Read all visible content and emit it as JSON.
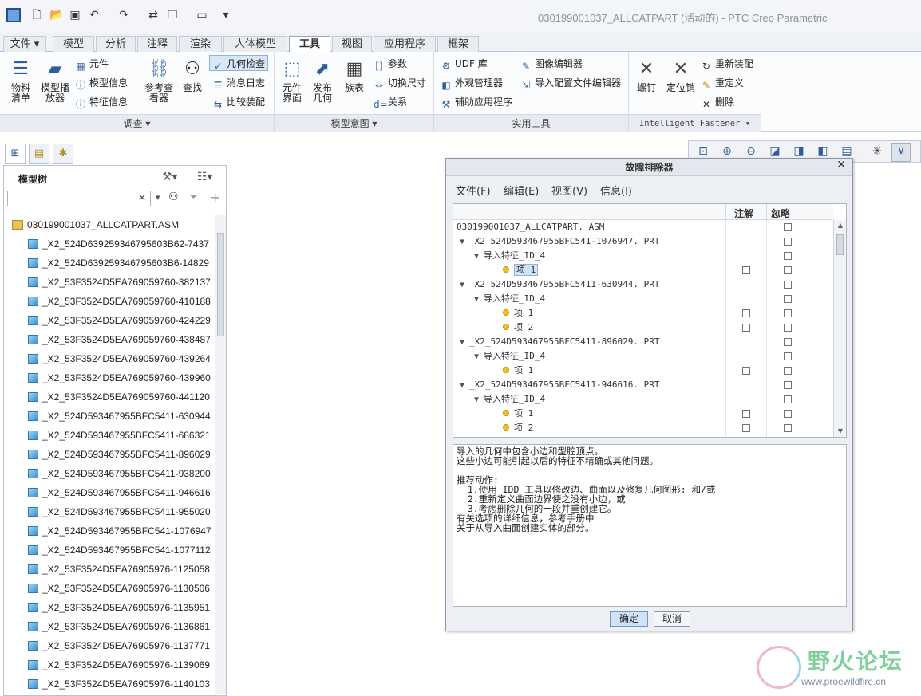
{
  "window": {
    "title": "030199001037_ALLCATPART (活动的) - PTC Creo Parametric"
  },
  "quick_access": [
    "new-icon",
    "open-icon",
    "save-icon",
    "undo-icon",
    "redo-icon",
    "regenerate-icon",
    "windows-icon",
    "close-window-icon",
    "customize-icon"
  ],
  "tabs": [
    {
      "label": "文件 ▾"
    },
    {
      "label": "模型"
    },
    {
      "label": "分析"
    },
    {
      "label": "注释"
    },
    {
      "label": "渲染"
    },
    {
      "label": "人体模型"
    },
    {
      "label": "工具"
    },
    {
      "label": "视图"
    },
    {
      "label": "应用程序"
    },
    {
      "label": "框架"
    }
  ],
  "ribbon": {
    "investigate": {
      "label": "调查 ▾",
      "bom": "物料\n清单",
      "model_player": "模型播\n放器",
      "component": "元件",
      "model_info": "模型信息",
      "feature_info": "特征信息",
      "reference_viewer": "参考查\n看器",
      "find": "查找",
      "geometry_check": "几何检查",
      "message_log": "消息日志",
      "compare_assembly": "比较装配"
    },
    "model_intent": {
      "label": "模型意图 ▾",
      "component_interface": "元件\n界面",
      "publish_geometry": "发布\n几何",
      "family_table": "族表",
      "parameters": "参数",
      "switch_dimensions": "切换尺寸",
      "relations": "关系"
    },
    "utilities": {
      "label": "实用工具",
      "udf_library": "UDF 库",
      "appearance_manager": "外观管理器",
      "auxiliary_apps": "辅助应用程序",
      "image_editor": "图像编辑器",
      "import_config_editor": "导入配置文件编辑器"
    },
    "fastener": {
      "label": "Intelligent Fastener ▾",
      "screw": "螺钉",
      "dowel": "定位销",
      "reassemble": "重新装配",
      "redefine": "重定义",
      "delete": "删除"
    }
  },
  "model_tree": {
    "title": "模型树",
    "search_placeholder": "",
    "root": "030199001037_ALLCATPART.ASM",
    "items": [
      "_X2_524D639259346795603B62-7437",
      "_X2_524D639259346795603B6-14829",
      "_X2_53F3524D5EA769059760-382137",
      "_X2_53F3524D5EA769059760-410188",
      "_X2_53F3524D5EA769059760-424229",
      "_X2_53F3524D5EA769059760-438487",
      "_X2_53F3524D5EA769059760-439264",
      "_X2_53F3524D5EA769059760-439960",
      "_X2_53F3524D5EA769059760-441120",
      "_X2_524D593467955BFC5411-630944",
      "_X2_524D593467955BFC5411-686321",
      "_X2_524D593467955BFC5411-896029",
      "_X2_524D593467955BFC5411-938200",
      "_X2_524D593467955BFC5411-946616",
      "_X2_524D593467955BFC5411-955020",
      "_X2_524D593467955BFC541-1076947",
      "_X2_524D593467955BFC541-1077112",
      "_X2_53F3524D5EA76905976-1125058",
      "_X2_53F3524D5EA76905976-1130506",
      "_X2_53F3524D5EA76905976-1135951",
      "_X2_53F3524D5EA76905976-1136861",
      "_X2_53F3524D5EA76905976-1137771",
      "_X2_53F3524D5EA76905976-1139069",
      "_X2_53F3524D5EA76905976-1140103"
    ]
  },
  "troubleshooter": {
    "title": "故障排除器",
    "menu": [
      "文件(F)",
      "编辑(E)",
      "视图(V)",
      "信息(I)"
    ],
    "col_note": "注解",
    "col_ignore": "忽略",
    "rows": [
      {
        "text": "030199001037_ALLCATPART. ASM",
        "level": 0,
        "kind": "root",
        "note": false
      },
      {
        "text": "_X2_524D593467955BFC541-1076947. PRT",
        "level": 1,
        "kind": "part",
        "note": false
      },
      {
        "text": "导入特征_ID_4",
        "level": 2,
        "kind": "feature",
        "note": false
      },
      {
        "text": "项 1",
        "level": 3,
        "kind": "item",
        "note": true,
        "selected": true
      },
      {
        "text": "_X2_524D593467955BFC5411-630944. PRT",
        "level": 1,
        "kind": "part",
        "note": false
      },
      {
        "text": "导入特征_ID_4",
        "level": 2,
        "kind": "feature",
        "note": false
      },
      {
        "text": "项 1",
        "level": 3,
        "kind": "item",
        "note": true
      },
      {
        "text": "项 2",
        "level": 3,
        "kind": "item",
        "note": true
      },
      {
        "text": "_X2_524D593467955BFC5411-896029. PRT",
        "level": 1,
        "kind": "part",
        "note": false
      },
      {
        "text": "导入特征_ID_4",
        "level": 2,
        "kind": "feature",
        "note": false
      },
      {
        "text": "项 1",
        "level": 3,
        "kind": "item",
        "note": true
      },
      {
        "text": "_X2_524D593467955BFC5411-946616. PRT",
        "level": 1,
        "kind": "part",
        "note": false
      },
      {
        "text": "导入特征_ID_4",
        "level": 2,
        "kind": "feature",
        "note": false
      },
      {
        "text": "项 1",
        "level": 3,
        "kind": "item",
        "note": true
      },
      {
        "text": "项 2",
        "level": 3,
        "kind": "item",
        "note": true
      }
    ],
    "message": "导入的几何中包含小边和型腔顶点。\n这些小边可能引起以后的特征不精确或其他问题。\n\n推荐动作:\n  1.使用 IDD 工具以修改边、曲面以及修复几何图形: 和/或\n  2.重新定义曲面边界使之没有小边，或\n  3.考虑删除几何的一段并重创建它。\n有关选项的详细信息，参考手册中\n关于从导入曲面创建实体的部分。",
    "ok": "确定",
    "cancel": "取消"
  },
  "watermark": {
    "title": "野火论坛",
    "url": "www.proewildfire.cn"
  }
}
